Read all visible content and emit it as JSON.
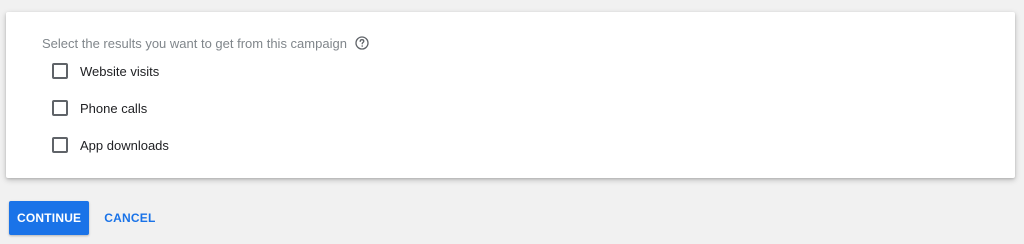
{
  "card": {
    "prompt": "Select the results you want to get from this campaign",
    "help_icon": "help-circle-icon",
    "options": [
      {
        "label": "Website visits",
        "checked": false
      },
      {
        "label": "Phone calls",
        "checked": false
      },
      {
        "label": "App downloads",
        "checked": false
      }
    ]
  },
  "actions": {
    "continue_label": "CONTINUE",
    "cancel_label": "CANCEL"
  },
  "colors": {
    "accent": "#1a73e8",
    "background": "#f1f1f1",
    "card": "#ffffff",
    "prompt_text": "#80868b",
    "option_text": "#202124",
    "checkbox_border": "#5f6368"
  }
}
